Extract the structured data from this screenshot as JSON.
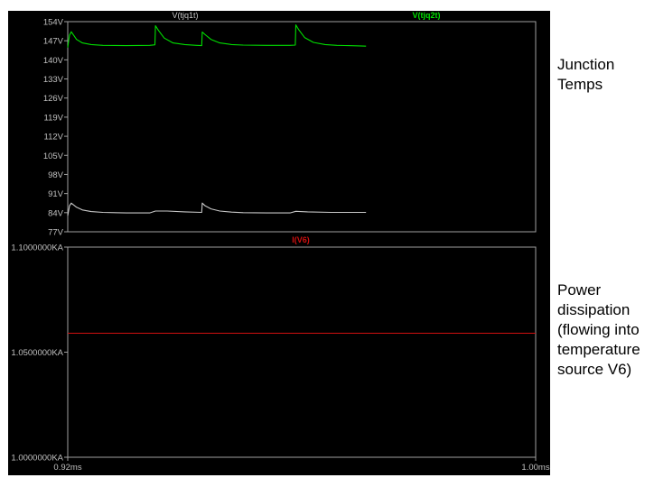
{
  "window": {
    "background": "#000000",
    "axis_color": "#a0a0a0",
    "tick_label_color": "#c0c0c0"
  },
  "annotations": {
    "top": [
      "Junction",
      "Temps"
    ],
    "bottom": [
      "Power",
      "dissipation",
      "(flowing into",
      "temperature",
      "source V6)"
    ]
  },
  "chart_data": [
    {
      "type": "line",
      "title": "",
      "legend": [
        "V(tjq1t)",
        "V(tjq2t)"
      ],
      "xlabel": "",
      "ylabel": "",
      "xlim": [
        0.92,
        1.0
      ],
      "ylim": [
        77,
        154
      ],
      "yticks": [
        154,
        147,
        140,
        133,
        126,
        119,
        112,
        105,
        98,
        91,
        84,
        77
      ],
      "ytick_labels": [
        "154V",
        "147V",
        "140V",
        "133V",
        "126V",
        "119V",
        "112V",
        "105V",
        "98V",
        "91V",
        "84V",
        "77V"
      ],
      "grid": false,
      "series": [
        {
          "name": "V(tjq2t)",
          "color": "#00e000",
          "points": [
            [
              0.92,
              144.5
            ],
            [
              0.9203,
              149.0
            ],
            [
              0.9206,
              150.3
            ],
            [
              0.9215,
              147.5
            ],
            [
              0.9225,
              146.2
            ],
            [
              0.924,
              145.6
            ],
            [
              0.926,
              145.3
            ],
            [
              0.93,
              145.2
            ],
            [
              0.934,
              145.3
            ],
            [
              0.9349,
              145.5
            ],
            [
              0.935,
              152.5
            ],
            [
              0.9355,
              150.8
            ],
            [
              0.9365,
              148.0
            ],
            [
              0.938,
              146.2
            ],
            [
              0.94,
              145.6
            ],
            [
              0.942,
              145.3
            ],
            [
              0.9429,
              145.2
            ],
            [
              0.943,
              150.2
            ],
            [
              0.9435,
              149.2
            ],
            [
              0.9445,
              147.5
            ],
            [
              0.946,
              146.2
            ],
            [
              0.948,
              145.6
            ],
            [
              0.95,
              145.4
            ],
            [
              0.954,
              145.3
            ],
            [
              0.958,
              145.3
            ],
            [
              0.9589,
              145.4
            ],
            [
              0.959,
              152.8
            ],
            [
              0.9595,
              151.0
            ],
            [
              0.9605,
              148.2
            ],
            [
              0.962,
              146.4
            ],
            [
              0.964,
              145.6
            ],
            [
              0.966,
              145.3
            ],
            [
              0.968,
              145.2
            ],
            [
              0.97,
              145.1
            ],
            [
              0.971,
              145.0
            ]
          ]
        },
        {
          "name": "V(tjq1t)",
          "color": "#c8c8c8",
          "points": [
            [
              0.92,
              82.9
            ],
            [
              0.9203,
              86.5
            ],
            [
              0.9206,
              87.5
            ],
            [
              0.9215,
              86.0
            ],
            [
              0.9225,
              85.0
            ],
            [
              0.924,
              84.4
            ],
            [
              0.926,
              84.1
            ],
            [
              0.93,
              83.9
            ],
            [
              0.934,
              83.9
            ],
            [
              0.935,
              84.6
            ],
            [
              0.937,
              84.6
            ],
            [
              0.94,
              84.3
            ],
            [
              0.9429,
              84.1
            ],
            [
              0.943,
              87.5
            ],
            [
              0.9435,
              86.5
            ],
            [
              0.9445,
              85.4
            ],
            [
              0.946,
              84.6
            ],
            [
              0.948,
              84.2
            ],
            [
              0.95,
              84.0
            ],
            [
              0.954,
              83.9
            ],
            [
              0.958,
              83.9
            ],
            [
              0.959,
              84.5
            ],
            [
              0.961,
              84.3
            ],
            [
              0.965,
              84.1
            ],
            [
              0.971,
              84.1
            ]
          ]
        }
      ]
    },
    {
      "type": "line",
      "title": "",
      "legend": [
        "I(V6)"
      ],
      "xlabel": "",
      "ylabel": "",
      "xlim": [
        0.92,
        1.0
      ],
      "ylim": [
        1.0,
        1.1
      ],
      "yticks": [
        1.1,
        1.05,
        1.0
      ],
      "ytick_labels": [
        "1.1000000KA",
        "1.0500000KA",
        "1.0000000KA"
      ],
      "xtick_labels": [
        "0.92ms",
        "1.00ms"
      ],
      "grid": false,
      "series": [
        {
          "name": "I(V6)",
          "color": "#d01010",
          "points": [
            [
              0.92,
              1.059
            ],
            [
              1.0,
              1.059
            ]
          ]
        }
      ]
    }
  ]
}
